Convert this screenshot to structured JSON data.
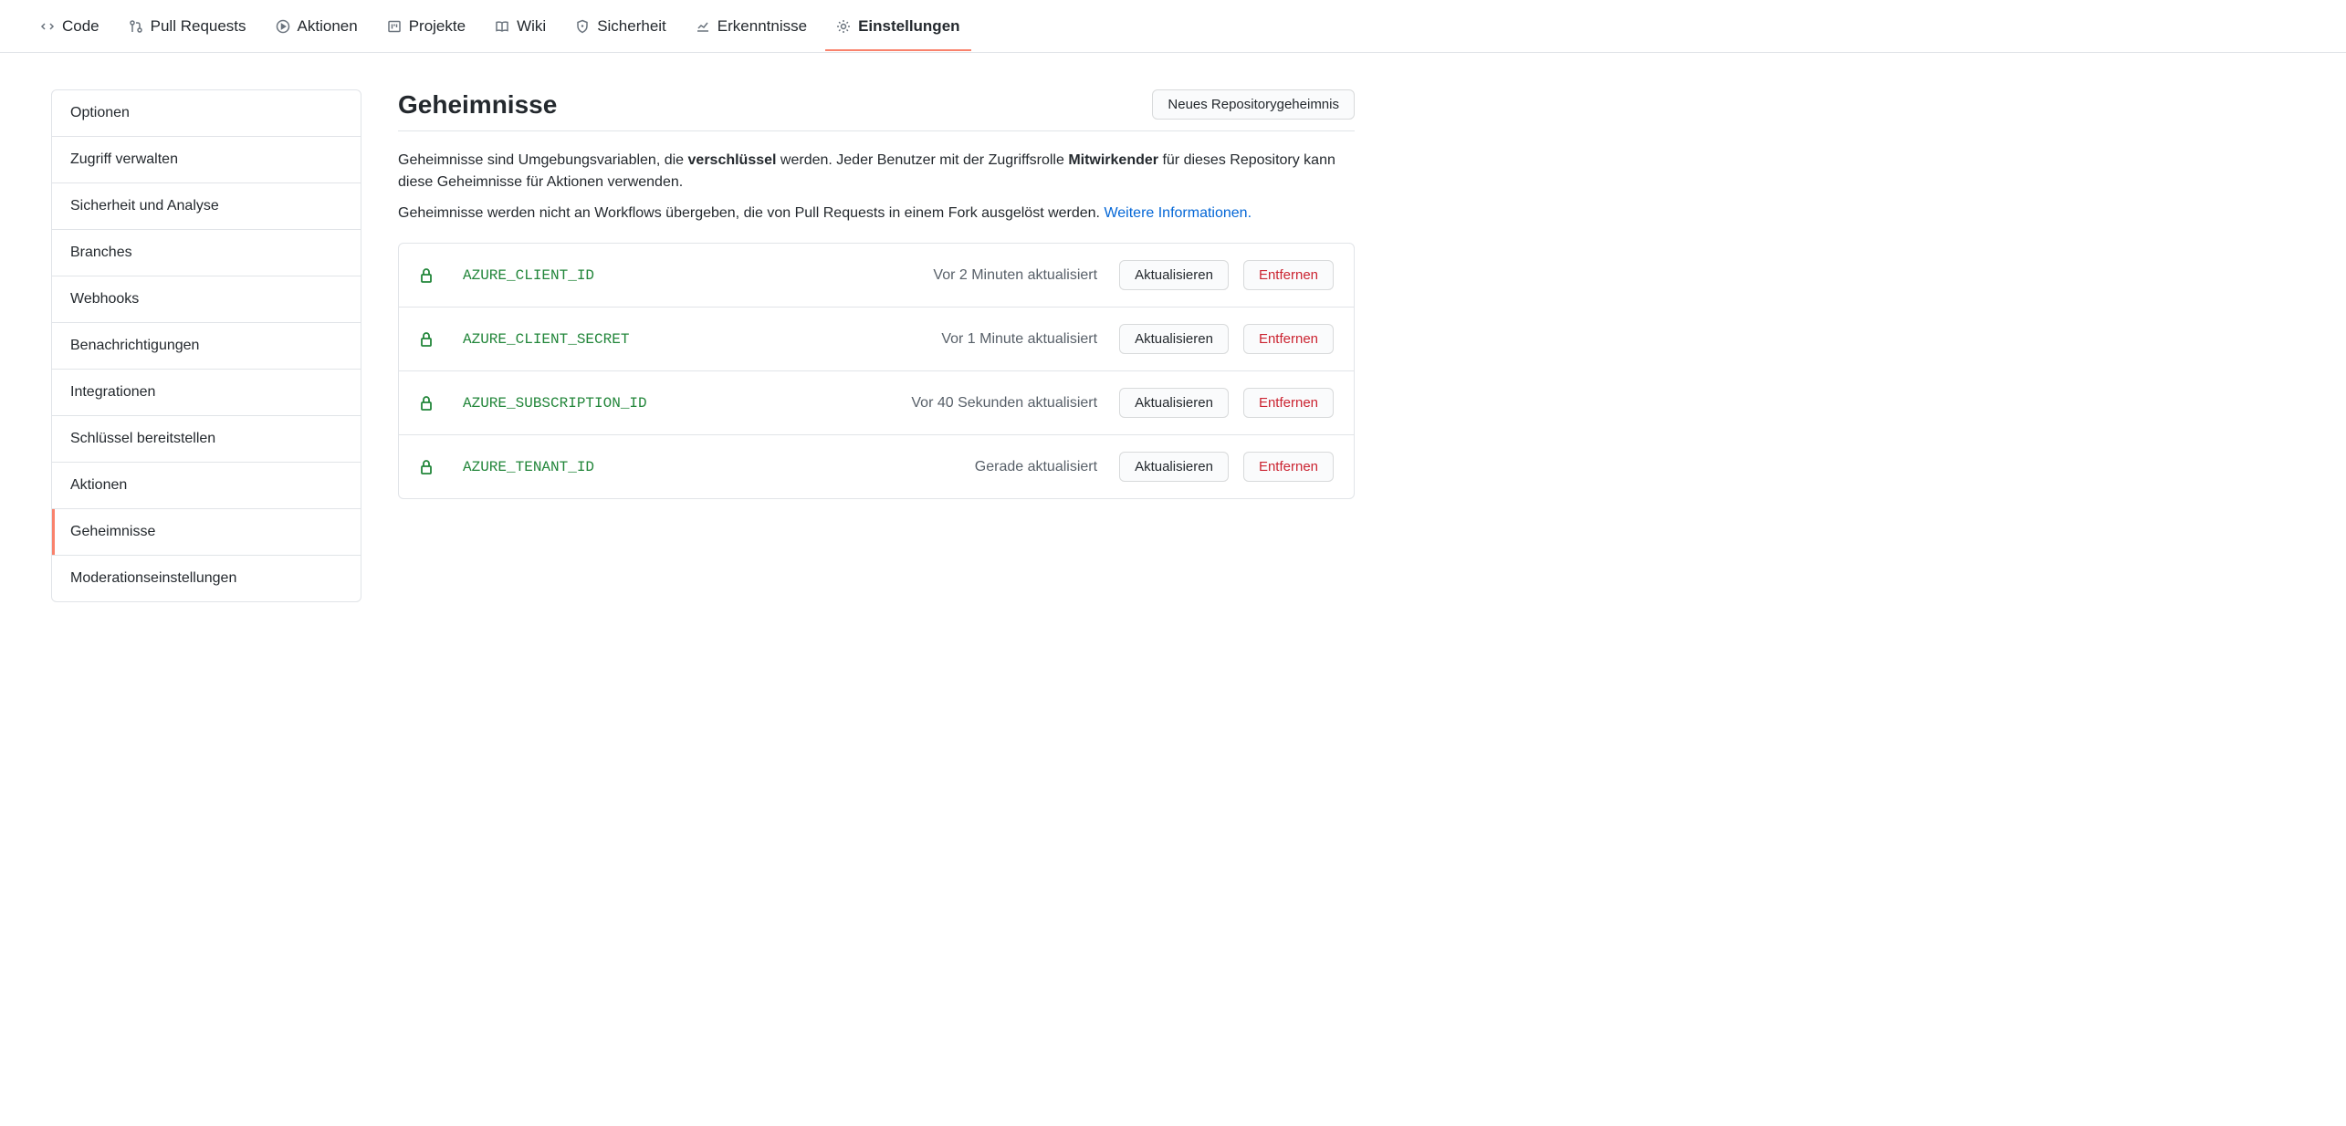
{
  "topnav": {
    "items": [
      {
        "label": "Code"
      },
      {
        "label": "Pull Requests"
      },
      {
        "label": "Aktionen"
      },
      {
        "label": "Projekte"
      },
      {
        "label": "Wiki"
      },
      {
        "label": "Sicherheit"
      },
      {
        "label": "Erkenntnisse"
      },
      {
        "label": "Einstellungen"
      }
    ]
  },
  "sidebar": {
    "items": [
      {
        "label": "Optionen"
      },
      {
        "label": "Zugriff verwalten"
      },
      {
        "label": "Sicherheit und Analyse"
      },
      {
        "label": "Branches"
      },
      {
        "label": "Webhooks"
      },
      {
        "label": "Benachrichtigungen"
      },
      {
        "label": "Integrationen"
      },
      {
        "label": "Schlüssel bereitstellen"
      },
      {
        "label": "Aktionen"
      },
      {
        "label": "Geheimnisse"
      },
      {
        "label": "Moderationseinstellungen"
      }
    ]
  },
  "page": {
    "title": "Geheimnisse",
    "new_secret_button": "Neues Repositorygeheimnis",
    "desc1_a": "Geheimnisse sind Umgebungsvariablen, die ",
    "desc1_b": "verschlüssel",
    "desc1_c": " werden. Jeder Benutzer mit der Zugriffsrolle ",
    "desc1_d": "Mitwirkender",
    "desc1_e": " für dieses Repository kann diese Geheimnisse für Aktionen verwenden.",
    "desc2_a": "Geheimnisse werden nicht an Workflows übergeben, die von Pull Requests in einem Fork ausgelöst werden. ",
    "desc2_link": "Weitere Informationen."
  },
  "buttons": {
    "update": "Aktualisieren",
    "remove": "Entfernen"
  },
  "secrets": [
    {
      "name": "AZURE_CLIENT_ID",
      "updated": "Vor 2 Minuten aktualisiert"
    },
    {
      "name": "AZURE_CLIENT_SECRET",
      "updated": "Vor 1 Minute aktualisiert"
    },
    {
      "name": "AZURE_SUBSCRIPTION_ID",
      "updated": "Vor 40 Sekunden aktualisiert"
    },
    {
      "name": "AZURE_TENANT_ID",
      "updated": "Gerade aktualisiert"
    }
  ]
}
